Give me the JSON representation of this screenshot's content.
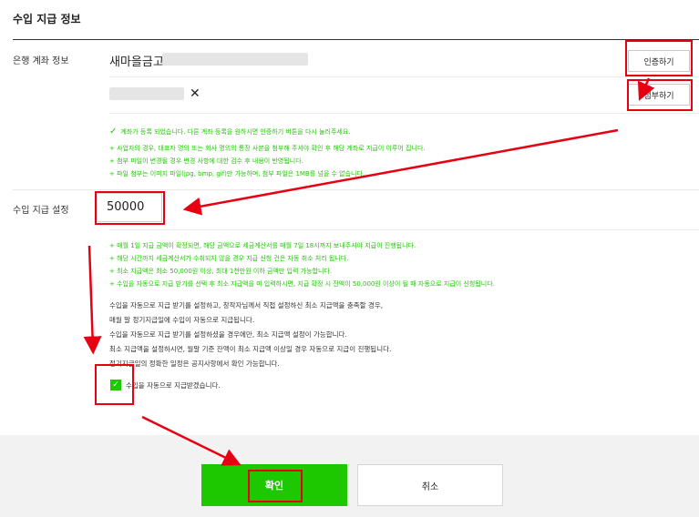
{
  "section": {
    "title": "수입 지급 정보"
  },
  "bank": {
    "label": "은행 계좌 정보",
    "bank_name": "새마을금고",
    "verify_button": "인증하기",
    "attach_button": "첨부하기",
    "remove_icon": "close-icon",
    "registered_notice": "계좌가 등록 되었습니다. 다른 계좌 등록을 원하시면 인증하기 버튼을 다시 눌러주세요.",
    "notes": [
      "+ 사업자의 경우, 대표자 명의 또는 회사 명의의 통장 사본을 첨부해 주셔야 확인 후 해당 계좌로 지급이 이루어 집니다.",
      "+ 첨부 파일이 변경될 경우 변경 사항에 대한 검수 후 내용이 반영됩니다.",
      "+ 파일 첨부는 이미지 파일(jpg, bmp, gif)만 가능하며, 첨부 파일은 1MB를 넘을 수 없습니다."
    ]
  },
  "payout": {
    "label": "수입 지급 설정",
    "amount_value": "50000",
    "notes": [
      "+ 매월 1일 지급 금액이 확정되면, 해당 금액으로 세금계산서를 매월 7일 18시까지 보내주셔야 지급이 진행됩니다.",
      "+ 해당 시간까지 세금계산서가 수취되지 않을 경우 지급 신청 건은 자동 취소 처리 됩니다.",
      "+ 최소 지급액은 최소 50,000원 이상, 최대 1천만원 이하 금액만 입력 가능합니다.",
      "+ 수입을 자동으로 지급 받기를 선택 후 최소 지급액을 미 입력하시면, 지급 확정 시 잔액이 50,000원 이상이 될 때 자동으로 지급이 신청됩니다."
    ],
    "description": [
      "수입을 자동으로 지급 받기를 설정하고, 창작자님께서 직접 설정하신 최소 지급액을 충족할 경우,",
      "매월 말 정기지급일에 수입이 자동으로 지급됩니다.",
      "수입을 자동으로 지급 받기를 설정하셨을 경우에만, 최소 지급액 설정이 가능합니다.",
      "최소 지급액을 설정하시면, 월말 기준 잔액이 최소 지급액 이상일 경우 자동으로 지급이 진행됩니다.",
      "정기지급일의 정확한 일정은 공지사항에서 확인 가능합니다."
    ],
    "auto_checkbox_label": "수입을 자동으로 지급받겠습니다."
  },
  "footer": {
    "confirm_button": "확인",
    "cancel_button": "취소"
  },
  "colors": {
    "accent_green": "#1ec800",
    "annotation_red": "#e60012"
  }
}
